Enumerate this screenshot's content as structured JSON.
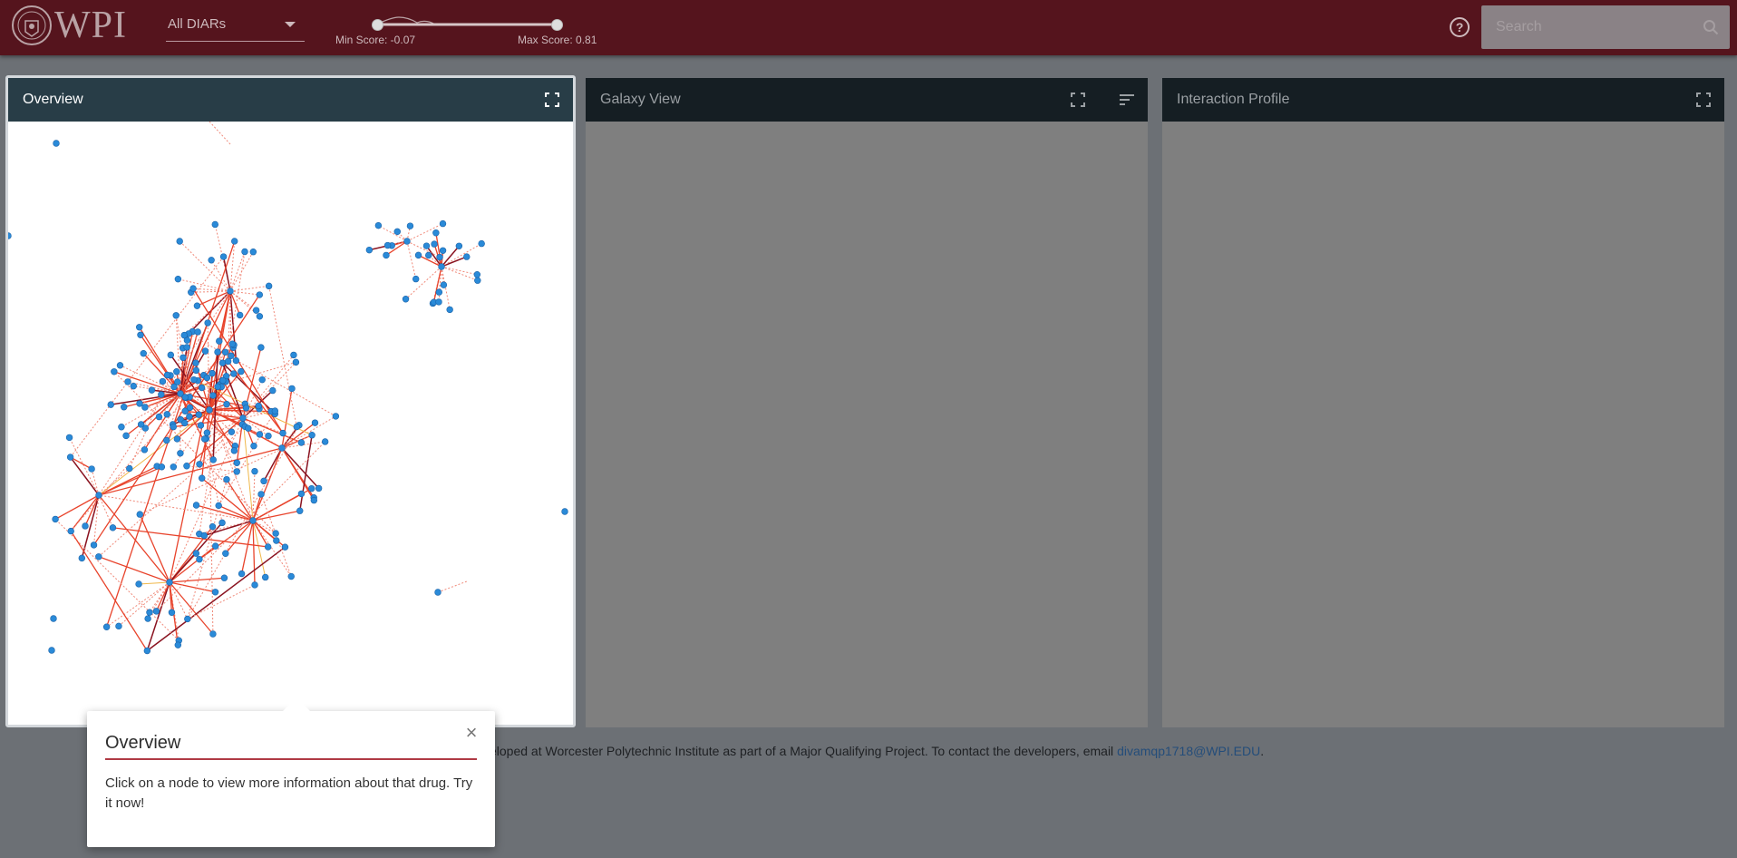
{
  "header": {
    "logo_text": "WPI",
    "diar_select": {
      "value": "All DIARs"
    },
    "slider": {
      "min_label": "Min Score: -0.07",
      "max_label": "Max Score: 0.81",
      "min_value": -0.07,
      "max_value": 0.81
    },
    "help_icon": "help-circle-icon",
    "search": {
      "placeholder": "Search",
      "value": "",
      "icon": "search-icon"
    }
  },
  "panels": {
    "overview": {
      "title": "Overview",
      "fullscreen_icon": "fullscreen-icon"
    },
    "galaxy": {
      "title": "Galaxy View",
      "fullscreen_icon": "fullscreen-icon",
      "sort_icon": "sort-icon"
    },
    "profile": {
      "title": "Interaction Profile",
      "fullscreen_icon": "fullscreen-icon"
    }
  },
  "footer": {
    "text": "eloped at Worcester Polytechnic Institute as part of a Major Qualifying Project. To contact the developers, email ",
    "email": "divamqp1718@WPI.EDU",
    "tail": "."
  },
  "popover": {
    "title": "Overview",
    "body": "Click on a node to view more information about that drug. Try it now!",
    "close_icon": "close-icon"
  },
  "colors": {
    "header_bg": "#55141d",
    "overview_header": "#283d47",
    "panel_header": "#151e23",
    "node": "#2a8ad8",
    "edge_strong": "#e8432b",
    "edge_dark": "#8a1320",
    "edge_weak": "#f08a7a",
    "edge_yellow": "#f0b84a",
    "link": "#244d7a"
  }
}
